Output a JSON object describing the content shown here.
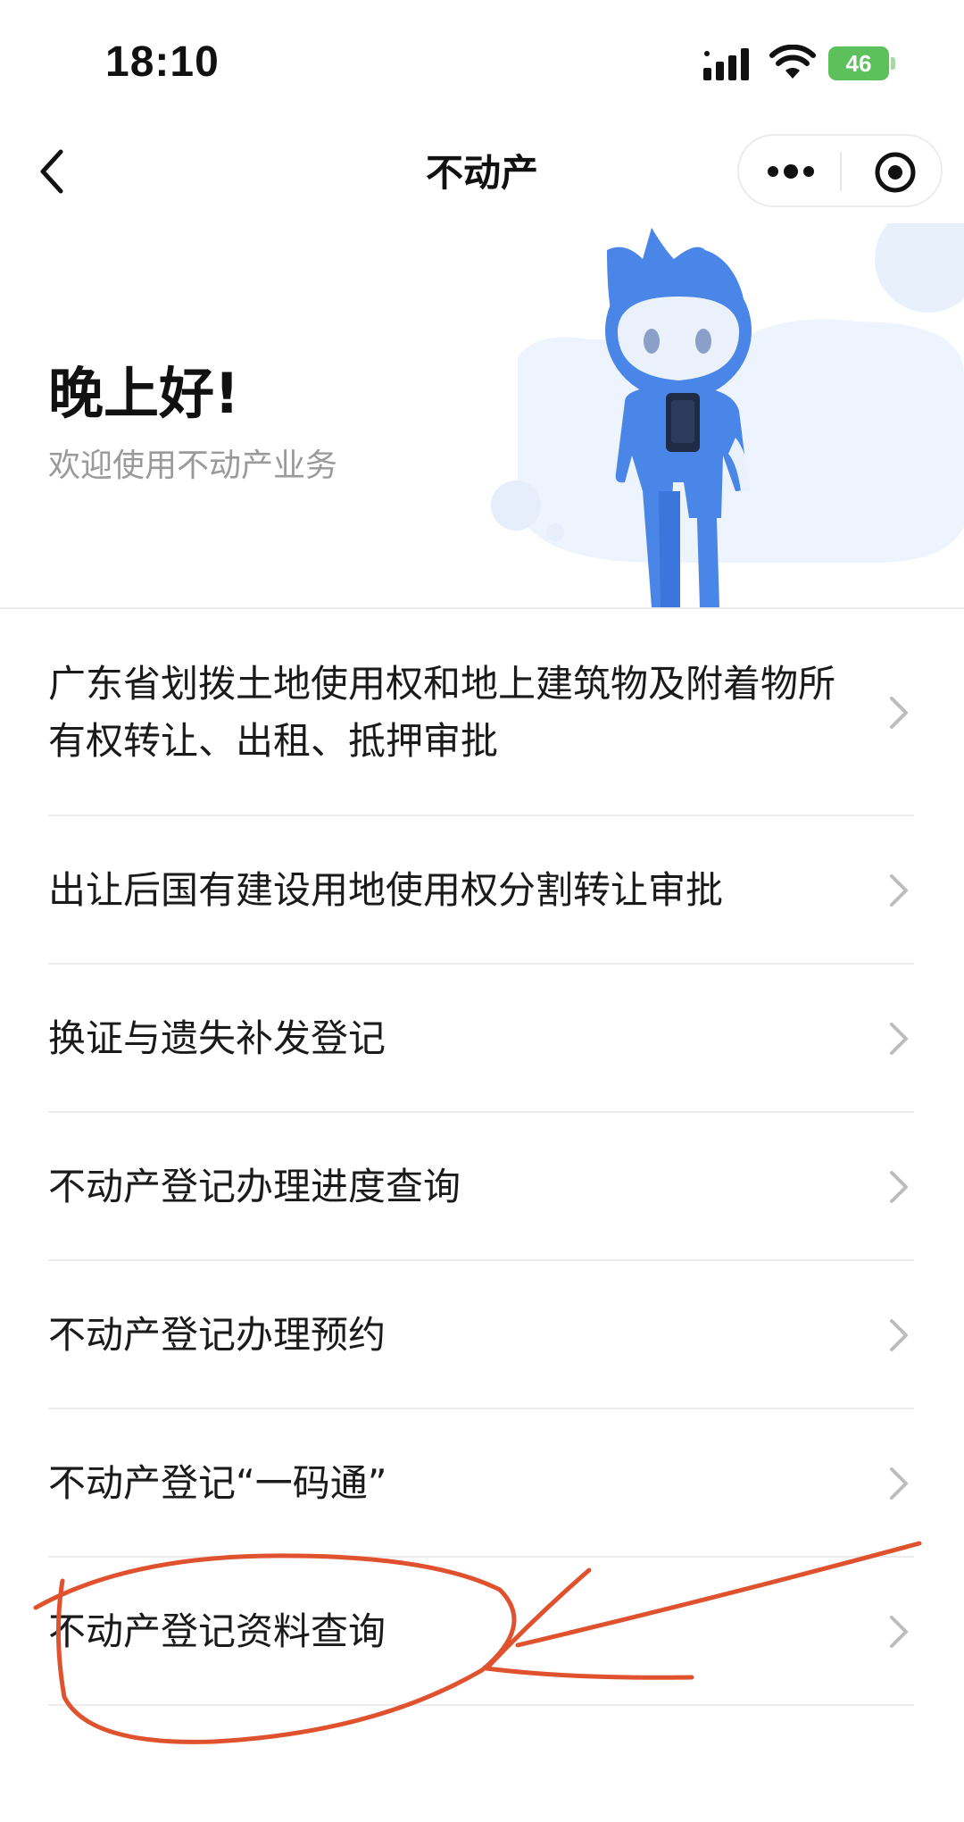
{
  "status_bar": {
    "time": "18:10",
    "battery": "46",
    "icons": [
      "signal-icon",
      "wifi-icon",
      "battery-icon"
    ]
  },
  "nav": {
    "title": "不动产",
    "back_icon": "chevron-left-icon",
    "more_icon": "more-dots-icon",
    "close_icon": "target-close-icon"
  },
  "banner": {
    "greeting": "晚上好!",
    "subtitle": "欢迎使用不动产业务"
  },
  "menu": {
    "items": [
      {
        "label": "广东省划拨土地使用权和地上建筑物及附着物所有权转让、出租、抵押审批"
      },
      {
        "label": "出让后国有建设用地使用权分割转让审批"
      },
      {
        "label": "换证与遗失补发登记"
      },
      {
        "label": "不动产登记办理进度查询"
      },
      {
        "label": "不动产登记办理预约"
      },
      {
        "label": "不动产登记“一码通”"
      },
      {
        "label": "不动产登记资料查询"
      }
    ]
  },
  "colors": {
    "mascot_blue": "#4a86e8",
    "annotation_red": "#e0522e",
    "battery_green": "#5cc15a"
  }
}
